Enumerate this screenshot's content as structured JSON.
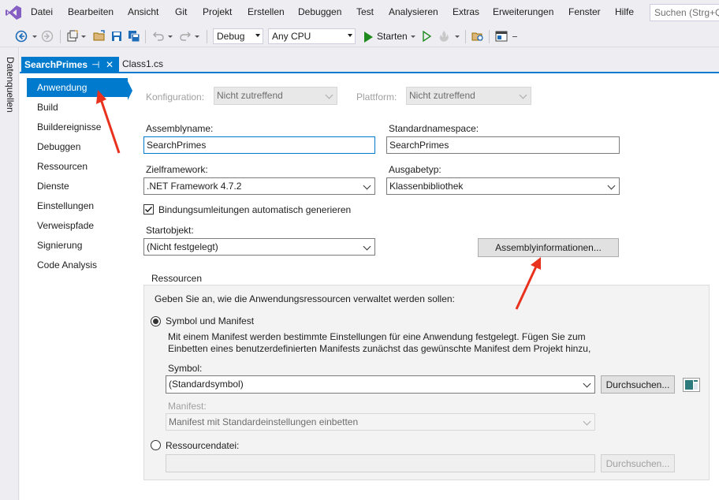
{
  "menubar": {
    "items": [
      "Datei",
      "Bearbeiten",
      "Ansicht",
      "Git",
      "Projekt",
      "Erstellen",
      "Debuggen",
      "Test",
      "Analysieren",
      "Extras",
      "Erweiterungen",
      "Fenster",
      "Hilfe"
    ],
    "search_placeholder": "Suchen (Strg+Q)"
  },
  "toolbar": {
    "config": "Debug",
    "platform": "Any CPU",
    "start_label": "Starten"
  },
  "side_panel": {
    "label": "Datenquellen"
  },
  "tabs": {
    "active": "SearchPrimes",
    "pin_glyph": "⊣",
    "close_glyph": "✕",
    "other": "Class1.cs"
  },
  "nav": {
    "items": [
      "Anwendung",
      "Build",
      "Buildereignisse",
      "Debuggen",
      "Ressourcen",
      "Dienste",
      "Einstellungen",
      "Verweispfade",
      "Signierung",
      "Code Analysis"
    ],
    "selected": "Anwendung"
  },
  "app": {
    "config_label": "Konfiguration:",
    "config_value": "Nicht zutreffend",
    "platform_label": "Plattform:",
    "platform_value": "Nicht zutreffend",
    "assembly_label": "Assemblyname:",
    "assembly_value": "SearchPrimes",
    "namespace_label": "Standardnamespace:",
    "namespace_value": "SearchPrimes",
    "framework_label": "Zielframework:",
    "framework_value": ".NET Framework 4.7.2",
    "output_label": "Ausgabetyp:",
    "output_value": "Klassenbibliothek",
    "binding_label": "Bindungsumleitungen automatisch generieren",
    "binding_checked": true,
    "startup_label": "Startobjekt:",
    "startup_value": "(Nicht festgelegt)",
    "assembly_info_button": "Assemblyinformationen..."
  },
  "resources": {
    "title": "Ressourcen",
    "intro": "Geben Sie an, wie die Anwendungsressourcen verwaltet werden sollen:",
    "option_icon_manifest": "Symbol und Manifest",
    "description_line1": "Mit einem Manifest werden bestimmte Einstellungen für eine Anwendung festgelegt. Fügen Sie zum",
    "description_line2": "Einbetten eines benutzerdefinierten Manifests zunächst das gewünschte Manifest dem Projekt hinzu,",
    "icon_label": "Symbol:",
    "icon_value": "(Standardsymbol)",
    "browse_button": "Durchsuchen...",
    "manifest_label": "Manifest:",
    "manifest_value": "Manifest mit Standardeinstellungen einbetten",
    "option_resource_file": "Ressourcendatei:",
    "resource_file_value": "",
    "browse_button_disabled": "Durchsuchen..."
  },
  "colors": {
    "accent": "#007acc",
    "annotation_arrow": "#e8321e",
    "start_green": "#1e8a1e"
  }
}
